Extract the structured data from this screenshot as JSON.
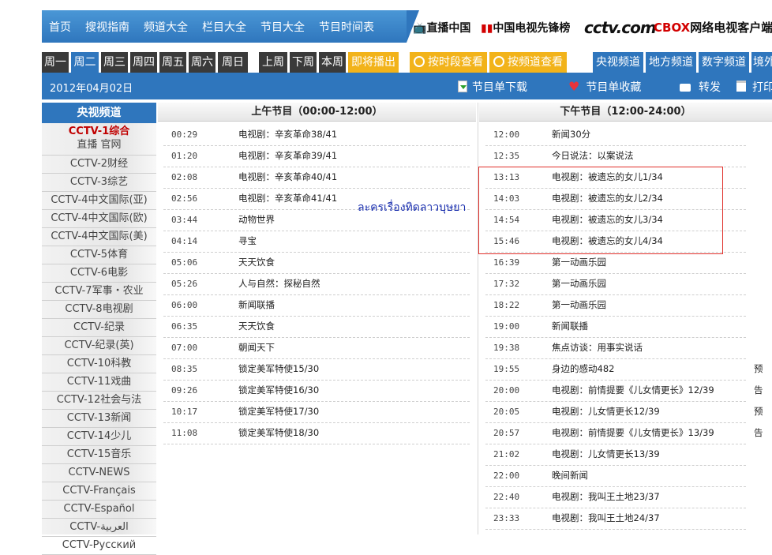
{
  "topnav": {
    "links": [
      "首页",
      "搜视指南",
      "频道大全",
      "栏目大全",
      "节目大全",
      "节目时间表"
    ],
    "brand1": "直播中国",
    "brand2": "中国电视先锋榜",
    "logo_cctv": "cctv.com",
    "logo_cbox": "CBOX",
    "brand3": "网络电视客户端"
  },
  "dayrow": {
    "days": [
      "周一",
      "周二",
      "周三",
      "周四",
      "周五",
      "周六",
      "周日"
    ],
    "weeks": [
      "上周",
      "下周",
      "本周"
    ],
    "upcoming": "即将播出",
    "by_time": "按时段查看",
    "by_channel": "按频道查看",
    "channel_tabs": [
      "央视频道",
      "地方频道",
      "数字频道",
      "境外"
    ]
  },
  "datebar": {
    "date": "2012年04月02日",
    "download": "节目单下载",
    "favorite": "节目单收藏",
    "share": "转发",
    "print": "打印"
  },
  "sidebar": {
    "title": "央视频道",
    "active": "CCTV-1综合",
    "active_sub": "直播 官网",
    "channels": [
      "CCTV-2财经",
      "CCTV-3综艺",
      "CCTV-4中文国际(亚)",
      "CCTV-4中文国际(欧)",
      "CCTV-4中文国际(美)",
      "CCTV-5体育",
      "CCTV-6电影",
      "CCTV-7军事・农业",
      "CCTV-8电视剧",
      "CCTV-纪录",
      "CCTV-纪录(英)",
      "CCTV-10科教",
      "CCTV-11戏曲",
      "CCTV-12社会与法",
      "CCTV-13新闻",
      "CCTV-14少儿",
      "CCTV-15音乐",
      "CCTV-NEWS",
      "CCTV-Français",
      "CCTV-Español",
      "CCTV-العربية",
      "CCTV-Русский"
    ]
  },
  "morning": {
    "header": "上午节目（00:00-12:00）",
    "rows": [
      {
        "time": "00:29",
        "name": "电视剧：辛亥革命38/41"
      },
      {
        "time": "01:20",
        "name": "电视剧：辛亥革命39/41"
      },
      {
        "time": "02:08",
        "name": "电视剧：辛亥革命40/41"
      },
      {
        "time": "02:56",
        "name": "电视剧：辛亥革命41/41"
      },
      {
        "time": "03:44",
        "name": "动物世界"
      },
      {
        "time": "04:14",
        "name": "寻宝"
      },
      {
        "time": "05:06",
        "name": "天天饮食"
      },
      {
        "time": "05:26",
        "name": "人与自然：探秘自然"
      },
      {
        "time": "06:00",
        "name": "新闻联播"
      },
      {
        "time": "06:35",
        "name": "天天饮食"
      },
      {
        "time": "07:00",
        "name": "朝闻天下"
      },
      {
        "time": "08:35",
        "name": "锁定美军特使15/30"
      },
      {
        "time": "09:26",
        "name": "锁定美军特使16/30"
      },
      {
        "time": "10:17",
        "name": "锁定美军特使17/30"
      },
      {
        "time": "11:08",
        "name": "锁定美军特使18/30"
      }
    ]
  },
  "afternoon": {
    "header": "下午节目（12:00-24:00）",
    "rows": [
      {
        "time": "12:00",
        "name": "新闻30分",
        "side": ""
      },
      {
        "time": "12:35",
        "name": "今日说法：以案说法",
        "side": ""
      },
      {
        "time": "13:13",
        "name": "电视剧：被遗忘的女儿1/34",
        "side": ""
      },
      {
        "time": "14:03",
        "name": "电视剧：被遗忘的女儿2/34",
        "side": ""
      },
      {
        "time": "14:54",
        "name": "电视剧：被遗忘的女儿3/34",
        "side": ""
      },
      {
        "time": "15:46",
        "name": "电视剧：被遗忘的女儿4/34",
        "side": ""
      },
      {
        "time": "16:39",
        "name": "第一动画乐园",
        "side": ""
      },
      {
        "time": "17:32",
        "name": "第一动画乐园",
        "side": ""
      },
      {
        "time": "18:22",
        "name": "第一动画乐园",
        "side": ""
      },
      {
        "time": "19:00",
        "name": "新闻联播",
        "side": ""
      },
      {
        "time": "19:38",
        "name": "焦点访谈：用事实说话",
        "side": ""
      },
      {
        "time": "19:55",
        "name": "身边的感动482",
        "side": "预告"
      },
      {
        "time": "20:00",
        "name": "电视剧：前情提要《儿女情更长》12/39",
        "side": ""
      },
      {
        "time": "20:05",
        "name": "电视剧：儿女情更长12/39",
        "side": "预告"
      },
      {
        "time": "20:57",
        "name": "电视剧：前情提要《儿女情更长》13/39",
        "side": ""
      },
      {
        "time": "21:02",
        "name": "电视剧：儿女情更长13/39",
        "side": ""
      },
      {
        "time": "22:00",
        "name": "晚间新闻",
        "side": ""
      },
      {
        "time": "22:40",
        "name": "电视剧：我叫王土地23/37",
        "side": ""
      },
      {
        "time": "23:33",
        "name": "电视剧：我叫王土地24/37",
        "side": ""
      }
    ]
  },
  "annotation": "ละครเรื่องทิดลาวบุษยา",
  "colors": {
    "nav_blue": "#2f76bd",
    "highlight_red": "#e0302b",
    "orange": "#f2b31a"
  }
}
